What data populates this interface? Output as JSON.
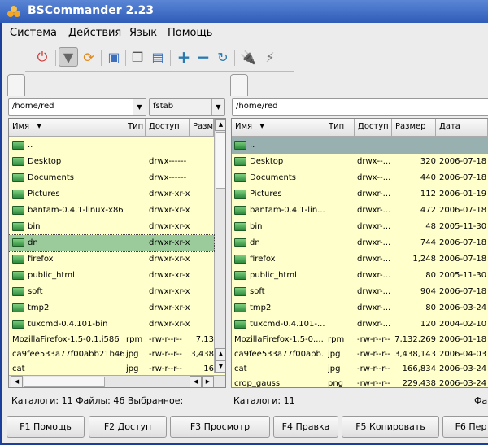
{
  "title": "BSCommander 2.23",
  "menu": [
    "Система",
    "Действия",
    "Язык",
    "Помощь"
  ],
  "toolbar_icons": [
    "quit-icon",
    "filter-icon",
    "sync-icon",
    "panel-icon",
    "copy-icon",
    "compare-icon",
    "select-plus-icon",
    "select-minus-icon",
    "refresh-icon",
    "connect-icon",
    "disconnect-icon"
  ],
  "left": {
    "path": "/home/red",
    "filter": "fstab",
    "columns": [
      "Имя",
      "Тип",
      "Доступ",
      "Размер"
    ],
    "rows": [
      {
        "name": "..",
        "dir": true,
        "type": "",
        "access": "",
        "size": ""
      },
      {
        "name": "Desktop",
        "dir": true,
        "type": "",
        "access": "drwx------",
        "size": ""
      },
      {
        "name": "Documents",
        "dir": true,
        "type": "",
        "access": "drwx------",
        "size": ""
      },
      {
        "name": "Pictures",
        "dir": true,
        "type": "",
        "access": "drwxr-xr-x",
        "size": ""
      },
      {
        "name": "bantam-0.4.1-linux-x86",
        "dir": true,
        "type": "",
        "access": "drwxr-xr-x",
        "size": ""
      },
      {
        "name": "bin",
        "dir": true,
        "type": "",
        "access": "drwxr-xr-x",
        "size": ""
      },
      {
        "name": "dn",
        "dir": true,
        "type": "",
        "access": "drwxr-xr-x",
        "size": "",
        "selected": true
      },
      {
        "name": "firefox",
        "dir": true,
        "type": "",
        "access": "drwxr-xr-x",
        "size": ""
      },
      {
        "name": "public_html",
        "dir": true,
        "type": "",
        "access": "drwxr-xr-x",
        "size": ""
      },
      {
        "name": "soft",
        "dir": true,
        "type": "",
        "access": "drwxr-xr-x",
        "size": ""
      },
      {
        "name": "tmp2",
        "dir": true,
        "type": "",
        "access": "drwxr-xr-x",
        "size": ""
      },
      {
        "name": "tuxcmd-0.4.101-bin",
        "dir": true,
        "type": "",
        "access": "drwxr-xr-x",
        "size": ""
      },
      {
        "name": "MozillaFirefox-1.5-0.1.i586",
        "dir": false,
        "type": "rpm",
        "access": "-rw-r--r--",
        "size": "7,13"
      },
      {
        "name": "ca9fee533a77f00abb21b46...",
        "dir": false,
        "type": "jpg",
        "access": "-rw-r--r--",
        "size": "3,438"
      },
      {
        "name": "cat",
        "dir": false,
        "type": "jpg",
        "access": "-rw-r--r--",
        "size": "16"
      }
    ]
  },
  "right": {
    "path": "/home/red",
    "columns": [
      "Имя",
      "Тип",
      "Доступ",
      "Размер",
      "Дата"
    ],
    "rows": [
      {
        "name": "..",
        "dir": true,
        "type": "",
        "access": "",
        "size": "",
        "date": "",
        "current": true
      },
      {
        "name": "Desktop",
        "dir": true,
        "type": "",
        "access": "drwx--...",
        "size": "320",
        "date": "2006-07-18"
      },
      {
        "name": "Documents",
        "dir": true,
        "type": "",
        "access": "drwx--...",
        "size": "440",
        "date": "2006-07-18"
      },
      {
        "name": "Pictures",
        "dir": true,
        "type": "",
        "access": "drwxr-...",
        "size": "112",
        "date": "2006-01-19"
      },
      {
        "name": "bantam-0.4.1-lin...",
        "dir": true,
        "type": "",
        "access": "drwxr-...",
        "size": "472",
        "date": "2006-07-18"
      },
      {
        "name": "bin",
        "dir": true,
        "type": "",
        "access": "drwxr-...",
        "size": "48",
        "date": "2005-11-30"
      },
      {
        "name": "dn",
        "dir": true,
        "type": "",
        "access": "drwxr-...",
        "size": "744",
        "date": "2006-07-18"
      },
      {
        "name": "firefox",
        "dir": true,
        "type": "",
        "access": "drwxr-...",
        "size": "1,248",
        "date": "2006-07-18"
      },
      {
        "name": "public_html",
        "dir": true,
        "type": "",
        "access": "drwxr-...",
        "size": "80",
        "date": "2005-11-30"
      },
      {
        "name": "soft",
        "dir": true,
        "type": "",
        "access": "drwxr-...",
        "size": "904",
        "date": "2006-07-18"
      },
      {
        "name": "tmp2",
        "dir": true,
        "type": "",
        "access": "drwxr-...",
        "size": "80",
        "date": "2006-03-24"
      },
      {
        "name": "tuxcmd-0.4.101-...",
        "dir": true,
        "type": "",
        "access": "drwxr-...",
        "size": "120",
        "date": "2004-02-10"
      },
      {
        "name": "MozillaFirefox-1.5-0....",
        "dir": false,
        "type": "rpm",
        "access": "-rw-r--r--",
        "size": "7,132,269",
        "date": "2006-01-18"
      },
      {
        "name": "ca9fee533a77f00abb...",
        "dir": false,
        "type": "jpg",
        "access": "-rw-r--r--",
        "size": "3,438,143",
        "date": "2006-04-03"
      },
      {
        "name": "cat",
        "dir": false,
        "type": "jpg",
        "access": "-rw-r--r--",
        "size": "166,834",
        "date": "2006-03-24"
      },
      {
        "name": "crop_gauss",
        "dir": false,
        "type": "png",
        "access": "-rw-r--r--",
        "size": "229,438",
        "date": "2006-03-24"
      }
    ]
  },
  "status": {
    "left": "Каталоги: 11  Файлы: 46  Выбранное:",
    "right": "Каталоги: 11",
    "right_tail": "Фа"
  },
  "fkeys": [
    "F1 Помощь",
    "F2 Доступ",
    "F3 Просмотр",
    "F4 Правка",
    "F5 Копировать",
    "F6 Пер"
  ]
}
